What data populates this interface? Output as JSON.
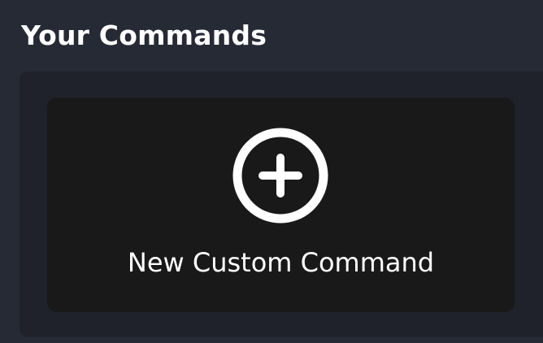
{
  "section": {
    "title": "Your Commands"
  },
  "new_command_card": {
    "label": "New Custom Command",
    "icon": "plus-circle-icon"
  },
  "colors": {
    "page_background": "#262a35",
    "panel_background": "#1f222b",
    "card_background": "#191919",
    "text": "#ffffff"
  }
}
